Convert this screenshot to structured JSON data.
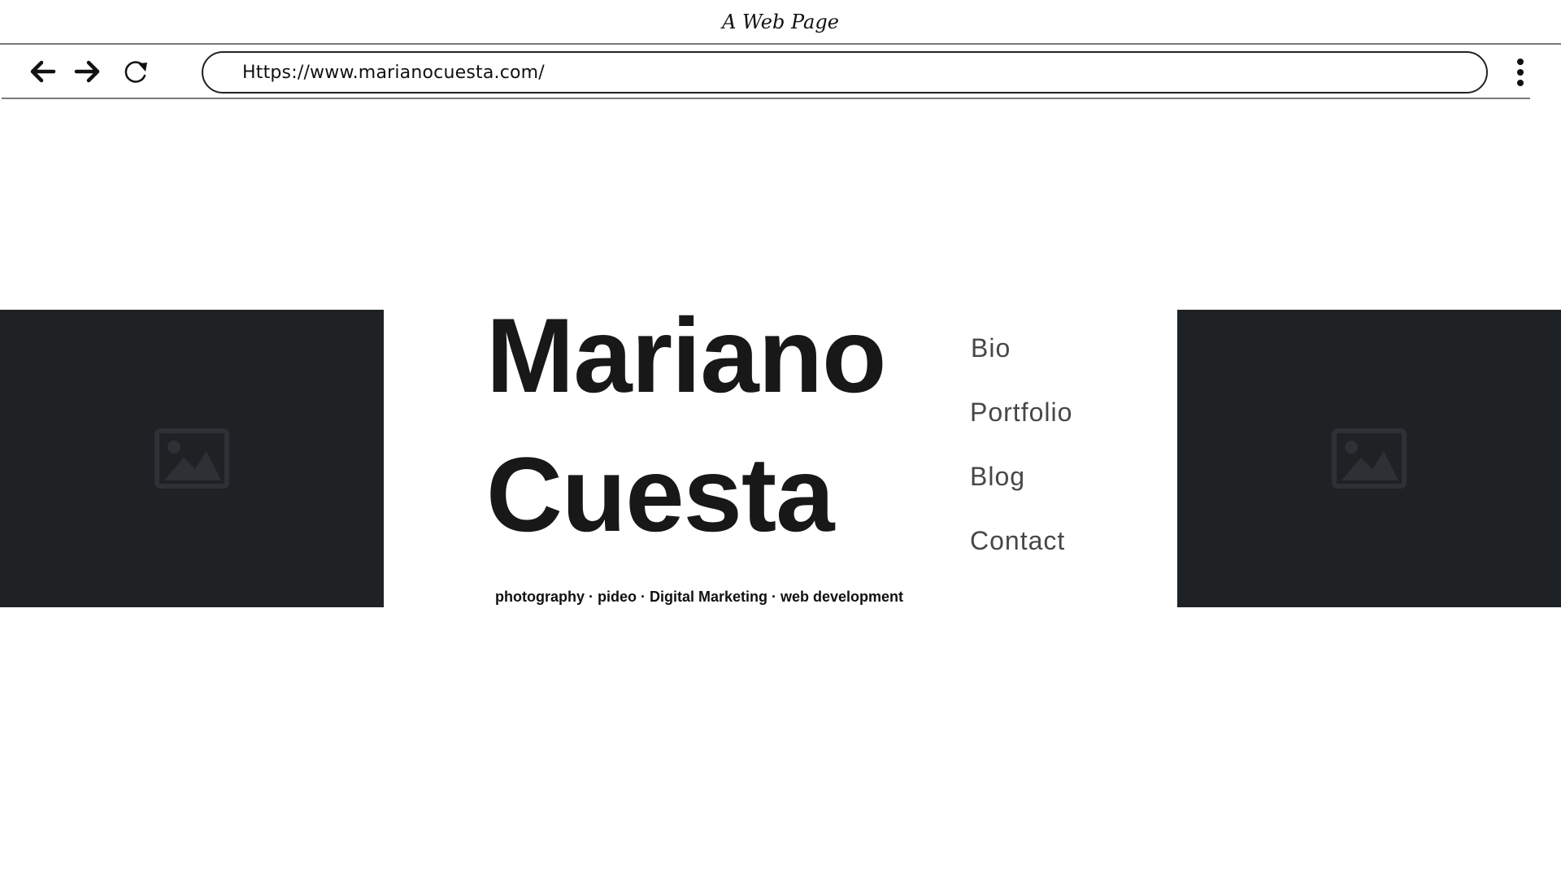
{
  "window": {
    "title": "A Web Page"
  },
  "toolbar": {
    "url": "Https://www.marianocuesta.com/",
    "back_icon": "arrow-left-icon",
    "forward_icon": "arrow-right-icon",
    "reload_icon": "reload-icon",
    "menu_icon": "kebab-menu-icon"
  },
  "hero": {
    "first_name": "Mariano",
    "last_name": "Cuesta",
    "tagline": "photography · pideo · Digital Marketing · web development"
  },
  "nav": {
    "items": [
      {
        "label": "Bio"
      },
      {
        "label": "Portfolio"
      },
      {
        "label": "Blog"
      },
      {
        "label": "Contact"
      }
    ]
  },
  "images": {
    "placeholder_icon": "image-icon",
    "background_color": "#1f2225",
    "icon_color": "#2d3135"
  }
}
